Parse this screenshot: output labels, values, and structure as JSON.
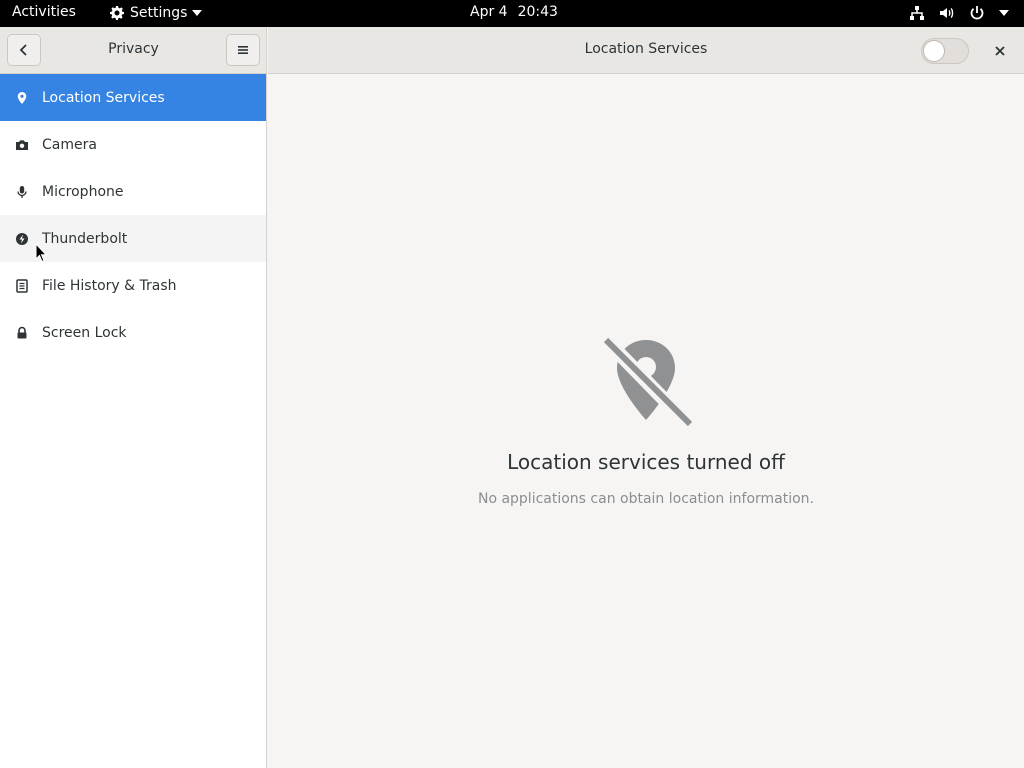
{
  "topbar": {
    "activities": "Activities",
    "app_name": "Settings",
    "date": "Apr 4",
    "time": "20:43"
  },
  "window": {
    "sidebar_title": "Privacy",
    "content_title": "Location Services",
    "location_switch_on": false
  },
  "sidebar": {
    "items": [
      {
        "label": "Location Services",
        "icon": "location-pin-icon"
      },
      {
        "label": "Camera",
        "icon": "camera-icon"
      },
      {
        "label": "Microphone",
        "icon": "microphone-icon"
      },
      {
        "label": "Thunderbolt",
        "icon": "thunderbolt-icon"
      },
      {
        "label": "File History & Trash",
        "icon": "file-history-icon"
      },
      {
        "label": "Screen Lock",
        "icon": "lock-icon"
      }
    ]
  },
  "main": {
    "empty_title": "Location services turned off",
    "empty_subtitle": "No applications can obtain location information."
  },
  "colors": {
    "accent": "#3584e4",
    "topbar": "#000000",
    "header": "#e9e7e4",
    "text": "#2e3436",
    "muted": "#8b8e8f"
  }
}
